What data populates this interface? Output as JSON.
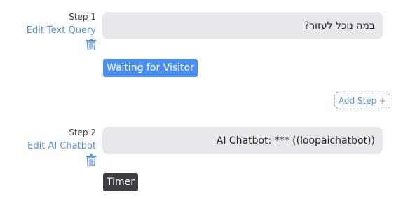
{
  "steps": [
    {
      "label": "Step 1",
      "edit_label": "Edit Text Query",
      "message": "במה נוכל לעזור?",
      "badge": "Waiting for Visitor"
    },
    {
      "label": "Step 2",
      "edit_label": "Edit AI Chatbot",
      "message": "AI Chatbot: *** ((loopaichatbot))",
      "badge": "Timer"
    }
  ],
  "add_step_label": "Add Step +",
  "colors": {
    "link": "#5a8fd6",
    "waiting_badge": "#4a8ff0",
    "timer_badge": "#3d3e40",
    "bubble": "#e8e8ea"
  },
  "icons": {
    "delete": "trash-icon"
  }
}
